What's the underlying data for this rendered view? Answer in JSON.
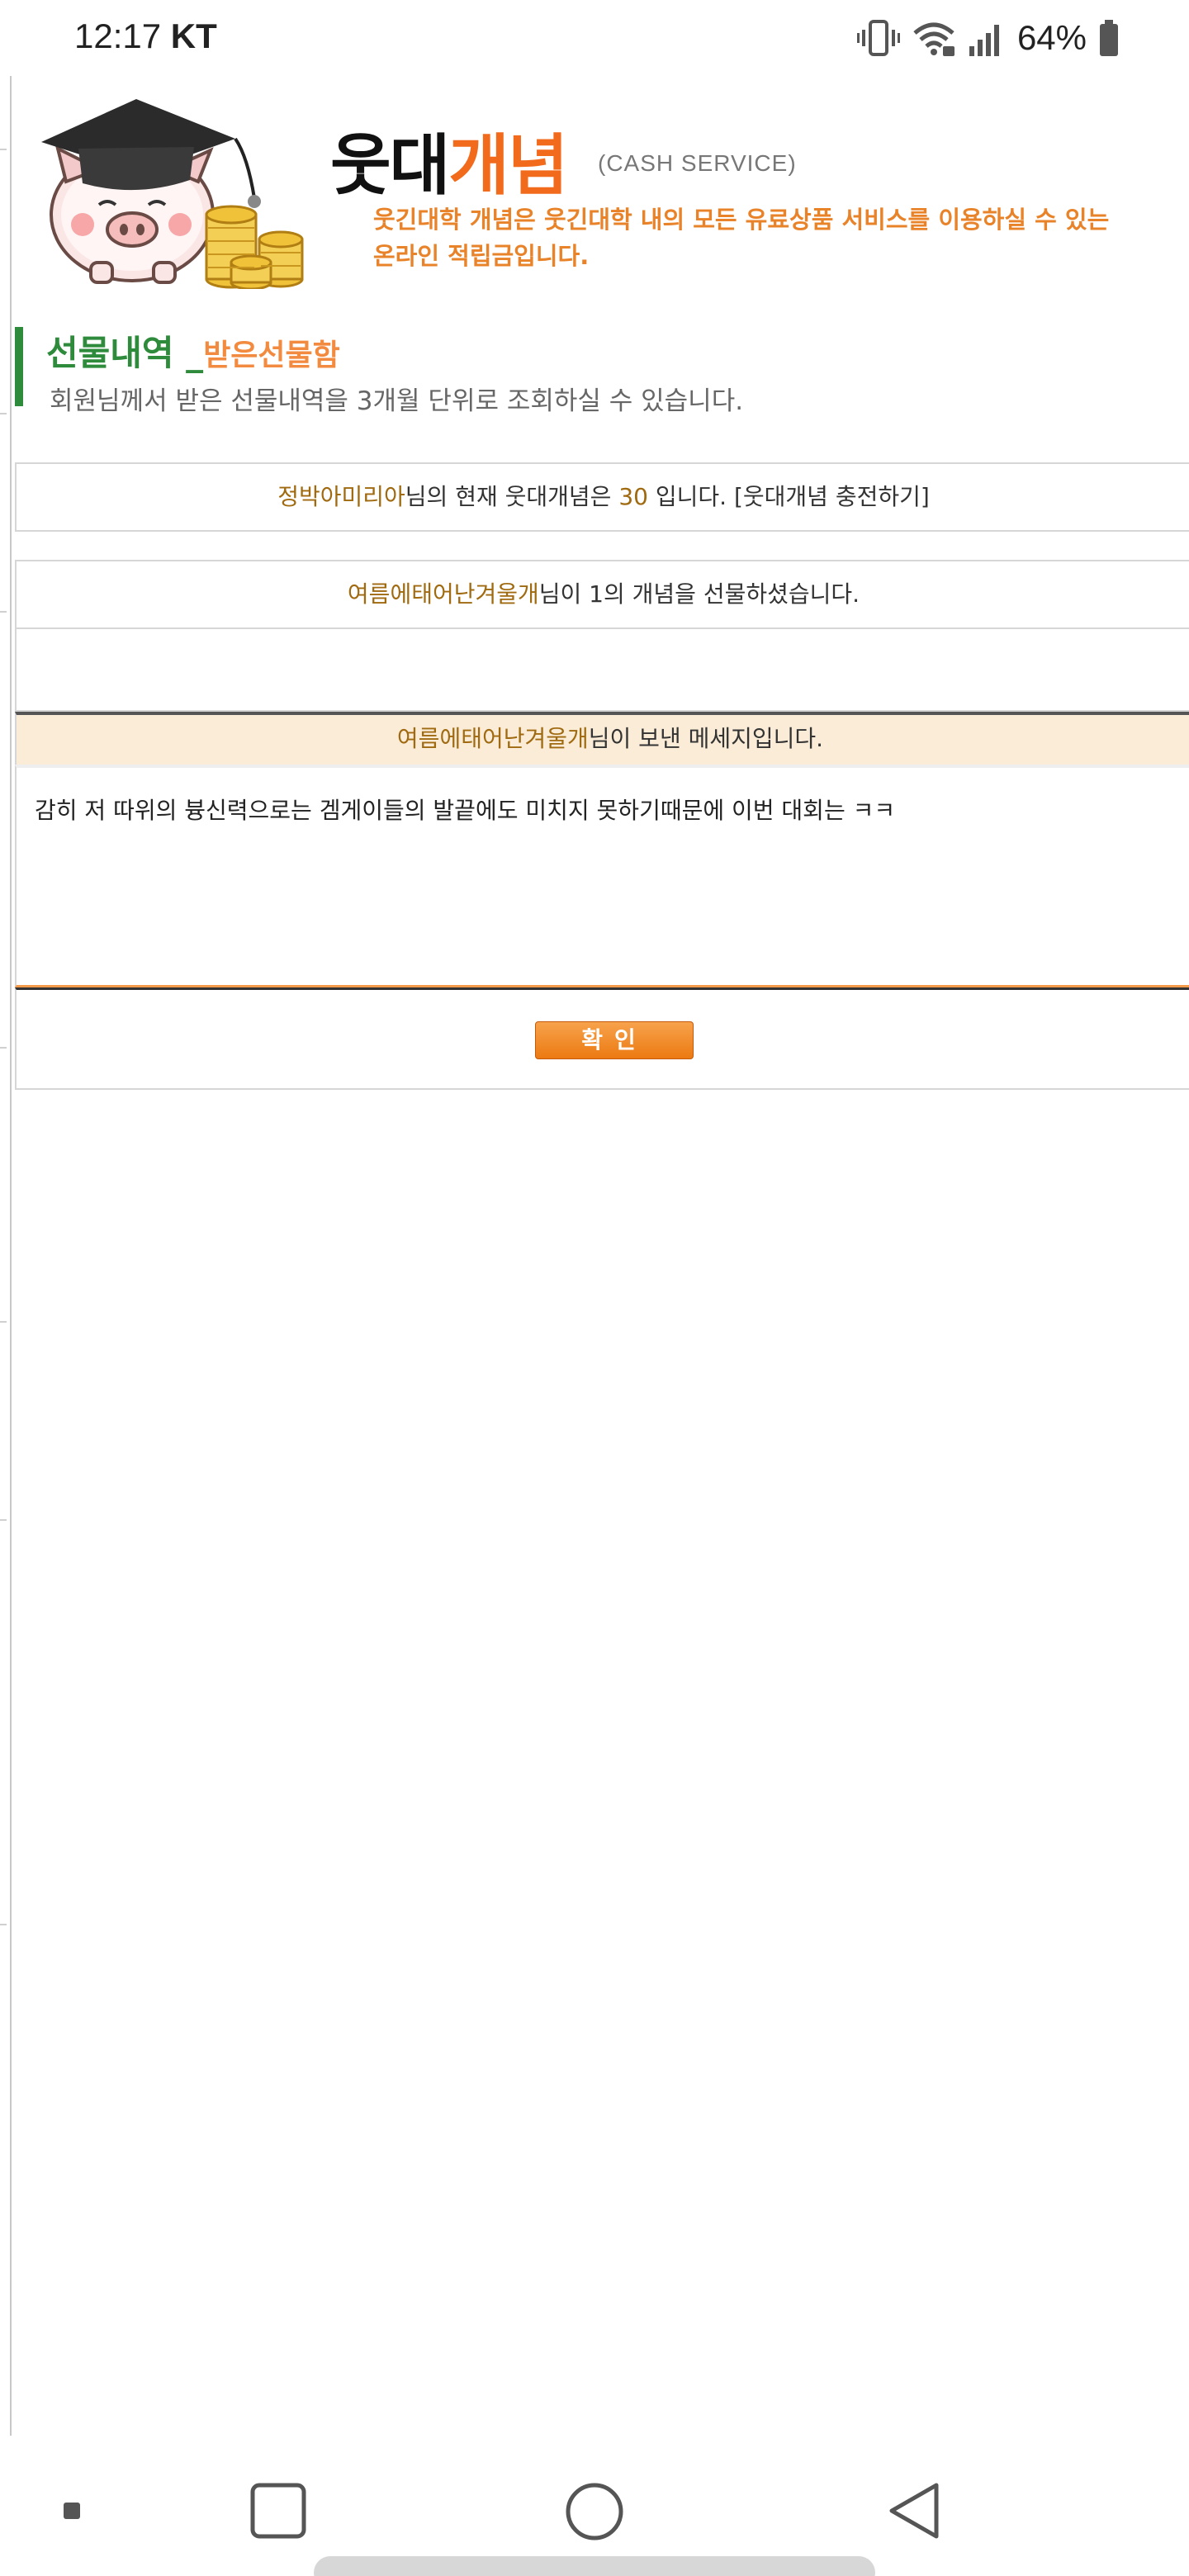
{
  "status_bar": {
    "time": "12:17",
    "carrier": "KT",
    "battery_percent": "64%",
    "icons": [
      "vibrate-icon",
      "wifi-icon",
      "signal-icon",
      "battery-icon"
    ]
  },
  "header": {
    "brand_part1": "웃대",
    "brand_part2": "개념",
    "brand_subtitle": "(CASH SERVICE)",
    "description_line1": "웃긴대학 개념은 웃긴대학 내의 모든 유료상품 서비스를 이용하실 수 있는",
    "description_line2": "온라인 적립금입니다.",
    "logo": "pig-graduate-coins-logo"
  },
  "section": {
    "title": "선물내역",
    "title_sep": " _",
    "subtitle": "받은선물함",
    "note": "회원님께서 받은 선물내역을 3개월 단위로 조회하실 수 있습니다."
  },
  "balance": {
    "user": "정박아미리아",
    "text_mid": "님의 현재 웃대개념은 ",
    "amount": "30",
    "text_end": " 입니다. [웃대개념 충전하기]"
  },
  "gift": {
    "sender": "여름에태어난겨울개",
    "text": "님이 1의 개념을 선물하셨습니다."
  },
  "message": {
    "sender": "여름에태어난겨울개",
    "header_text": "님이 보낸 메세지입니다.",
    "body": "감히 저 따위의 븅신력으로는 겜게이들의 발끝에도 미치지 못하기때문에 이번 대회는 ㅋㅋ"
  },
  "confirm_button": "확인",
  "colors": {
    "accent_orange": "#f26b1d",
    "green": "#2e8b3c",
    "highlight": "#a06a10",
    "message_header_bg": "#fbecd8"
  },
  "nav_bar": {
    "icons": [
      "recent-dot-icon",
      "square-icon",
      "home-circle-icon",
      "back-triangle-icon"
    ]
  }
}
